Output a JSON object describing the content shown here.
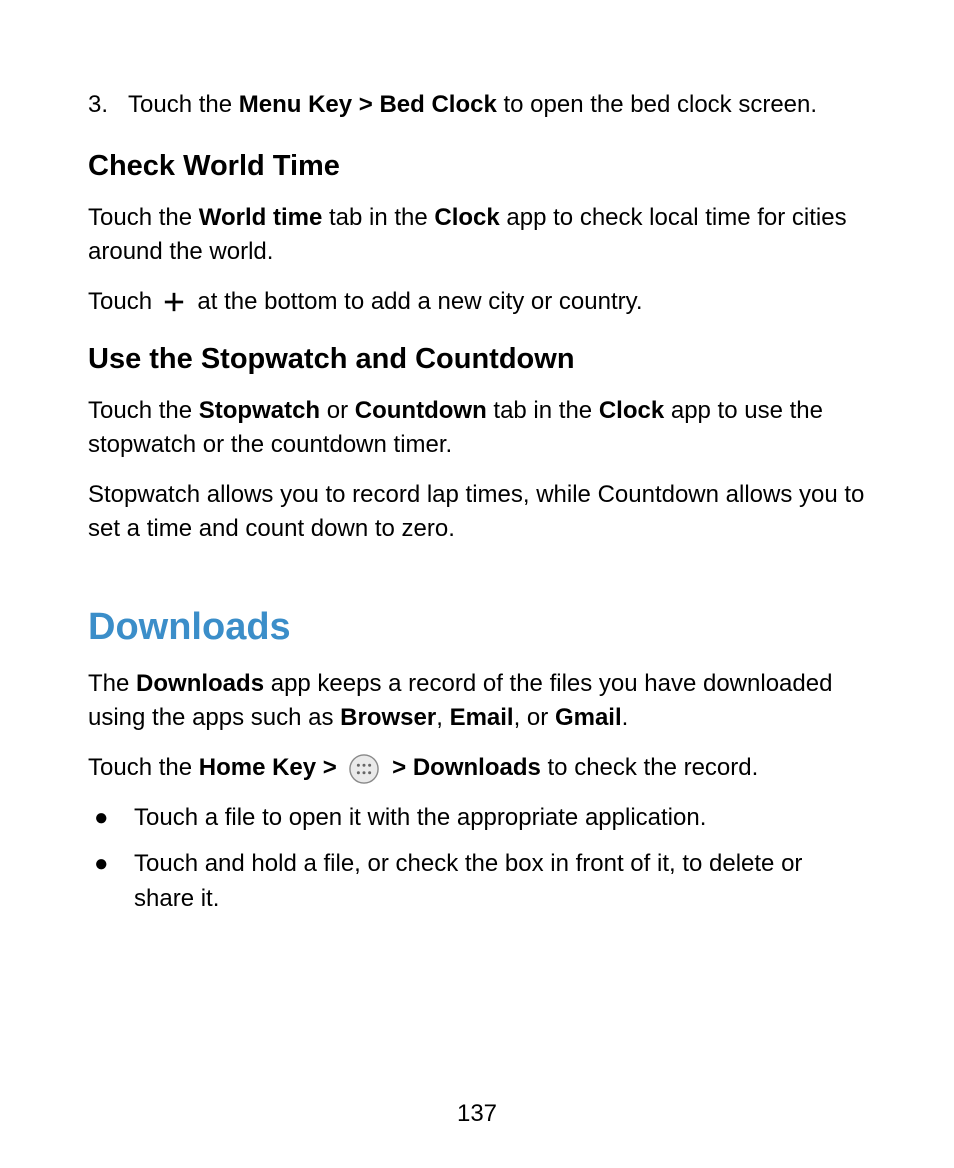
{
  "step3": {
    "num": "3.",
    "pre": "Touch the ",
    "bold": "Menu Key > Bed Clock",
    "post": " to open the bed clock screen."
  },
  "worldTime": {
    "heading": "Check World Time",
    "p1_pre": "Touch the ",
    "p1_b1": "World time",
    "p1_mid": " tab in the ",
    "p1_b2": "Clock",
    "p1_post": " app to check local time for cities around the world.",
    "p2_pre": "Touch ",
    "p2_post": " at the bottom to add a new city or country."
  },
  "stopwatch": {
    "heading": "Use the Stopwatch and Countdown",
    "p1_pre": "Touch the ",
    "p1_b1": "Stopwatch",
    "p1_mid1": " or ",
    "p1_b2": "Countdown",
    "p1_mid2": " tab in the ",
    "p1_b3": "Clock",
    "p1_post": " app to use the stopwatch or the countdown timer.",
    "p2": "Stopwatch allows you to record lap times, while Countdown allows you to set a time and count down to zero."
  },
  "downloads": {
    "heading": "Downloads",
    "p1_pre": "The ",
    "p1_b1": "Downloads",
    "p1_mid1": " app keeps a record of the files you have downloaded using the apps such as ",
    "p1_b2": "Browser",
    "p1_sep1": ", ",
    "p1_b3": "Email",
    "p1_sep2": ", or ",
    "p1_b4": "Gmail",
    "p1_end": ".",
    "p2_pre": "Touch the ",
    "p2_b1": "Home Key > ",
    "p2_b2": " > Downloads",
    "p2_post": " to check the record.",
    "bullets": [
      "Touch a file to open it with the appropriate application.",
      "Touch and hold a file, or check the box in front of it, to delete or share it."
    ]
  },
  "pageNumber": "137",
  "bulletGlyph": "●"
}
